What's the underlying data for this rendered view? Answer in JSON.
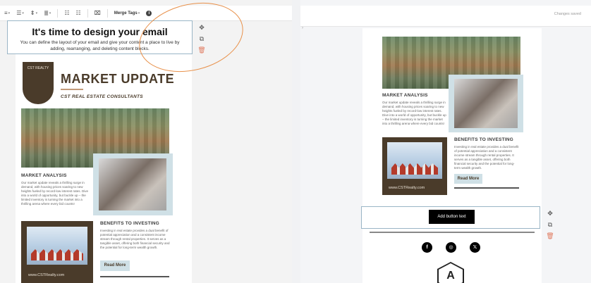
{
  "left": {
    "toolbar": {
      "merge_tags": "Merge Tags",
      "items": [
        "text-format",
        "align",
        "spacing",
        "heading",
        "list-ul",
        "list-ol",
        "clear-format"
      ]
    },
    "tooltip": {
      "title": "It's time to design your email",
      "body": "You can define the layout of your email and give your content a place to live by adding, rearranging, and deleting content blocks."
    },
    "email": {
      "crest_text": "CST REALTY",
      "title": "MARKET UPDATE",
      "subtitle": "CST REAL ESTATE CONSULTANTS",
      "market_heading": "MARKET ANALYSIS",
      "market_text": "Our market update reveals a thrilling surge in demand, with housing prices soaring to new heights fueled by record-low interest rates. Dive into a world of opportunity, but buckle up – the limited inventory is turning the market into a thrilling arena where every bid counts!",
      "benefits_heading": "BENEFITS TO INVESTING",
      "benefits_text": "Investing in real estate provides a dual benefit of potential appreciation and a consistent income stream through rental properties. It serves as a tangible asset, offering both financial security and the potential for long-term wealth growth.",
      "url": "www.CSTRealty.com",
      "read_more": "Read More"
    }
  },
  "right": {
    "status": "Changes saved",
    "chevron": "›",
    "email": {
      "market_heading": "MARKET ANALYSIS",
      "market_text": "Our market update reveals a thrilling surge in demand, with housing prices soaring to new heights fueled by record-low interest rates. Dive into a world of opportunity, but buckle up – the limited inventory is turning the market into a thrilling arena where every bid counts!",
      "benefits_heading": "BENEFITS TO INVESTING",
      "benefits_text": "Investing in real estate provides a dual benefit of potential appreciation and a consistent income stream through rental properties. It serves as a tangible asset, offering both financial security and the potential for long-term wealth growth.",
      "url": "www.CSTRealty.com",
      "read_more": "Read More",
      "button_text": "Add button text",
      "social": [
        "f",
        "◎",
        "𝕏"
      ],
      "footer_logo_letter": "A"
    }
  },
  "tools": {
    "move": "✥",
    "duplicate": "⧉",
    "delete": "🗑"
  },
  "colors": {
    "brand_brown": "#4a3b2a",
    "accent_blue": "#cfe0e6",
    "outline_blue": "#9ab5c6",
    "annotation_orange": "#e8914b"
  }
}
